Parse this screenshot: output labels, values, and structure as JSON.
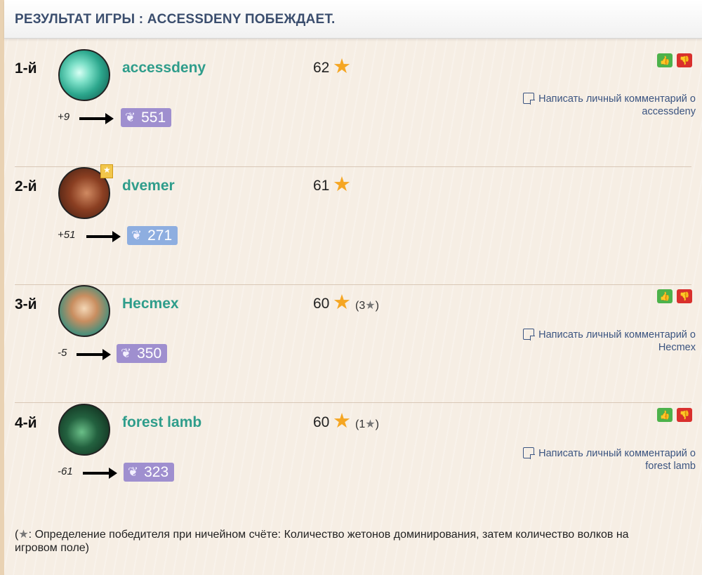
{
  "header": {
    "title": "РЕЗУЛЬТАТ ИГРЫ : ACCESSDENY ПОБЕЖДАЕТ."
  },
  "players": [
    {
      "rank": "1-й",
      "name": "accessdeny",
      "score": "62",
      "tiebreak": "",
      "delta": "+9",
      "elo": "551",
      "elo_color": "#9f8fcf",
      "comment": "Написать личный комментарий о",
      "comment_name": "accessdeny"
    },
    {
      "rank": "2-й",
      "name": "dvemer",
      "score": "61",
      "tiebreak": "",
      "delta": "+51",
      "elo": "271",
      "elo_color": "#8eaee0",
      "comment": "",
      "comment_name": ""
    },
    {
      "rank": "3-й",
      "name": "Hecmex",
      "score": "60",
      "tiebreak_open": "(3",
      "tiebreak_close": ")",
      "delta": "-5",
      "elo": "350",
      "elo_color": "#9f8fcf",
      "comment": "Написать личный комментарий о",
      "comment_name": "Hecmex"
    },
    {
      "rank": "4-й",
      "name": "forest lamb",
      "score": "60",
      "tiebreak_open": "(1",
      "tiebreak_close": ")",
      "delta": "-61",
      "elo": "323",
      "elo_color": "#9f8fcf",
      "comment": "Написать личный комментарий о",
      "comment_name": "forest lamb"
    }
  ],
  "footnote": {
    "open": "(",
    "text": ": Определение победителя при ничейном счёте: Количество жетонов доминирования, затем количество волков на игровом поле)"
  },
  "icons": {
    "star": "star-icon",
    "grey_star": "grey-star-icon",
    "laurel": "laurel-icon",
    "thumbs_up": "thumbs-up-icon",
    "thumbs_down": "thumbs-down-icon",
    "comment": "note-icon",
    "arrow": "right-arrow-icon"
  },
  "colors": {
    "name": "#2f9d8b",
    "header": "#3b4e6e",
    "link": "#3b5480",
    "star": "#f5a623"
  }
}
